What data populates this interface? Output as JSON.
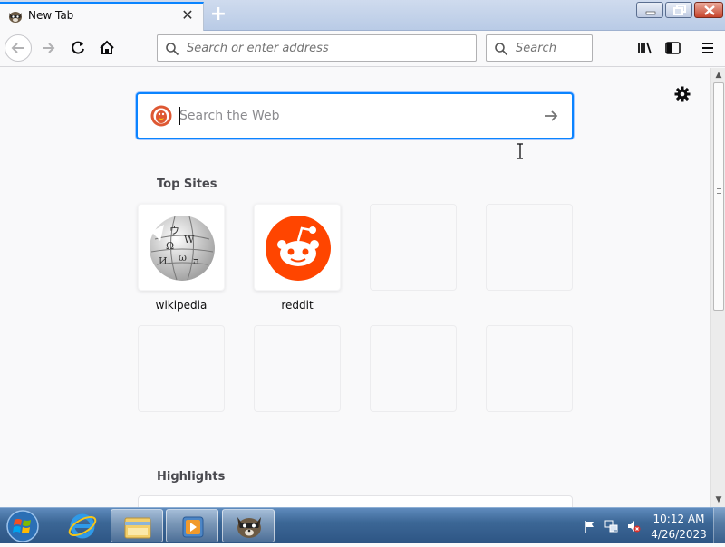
{
  "browser": {
    "tab": {
      "title": "New Tab",
      "favicon": "firefox-raccoon-icon"
    },
    "new_tab_symbol": "+",
    "nav": {
      "url_placeholder": "Search or enter address",
      "search_placeholder": "Search"
    }
  },
  "newtab": {
    "search_placeholder": "Search the Web",
    "top_sites_title": "Top Sites",
    "top_sites": [
      {
        "label": "wikipedia",
        "icon": "wikipedia-globe-icon"
      },
      {
        "label": "reddit",
        "icon": "reddit-icon"
      },
      {
        "label": "",
        "icon": ""
      },
      {
        "label": "",
        "icon": ""
      },
      {
        "label": "",
        "icon": ""
      },
      {
        "label": "",
        "icon": ""
      },
      {
        "label": "",
        "icon": ""
      },
      {
        "label": "",
        "icon": ""
      }
    ],
    "highlights_title": "Highlights"
  },
  "taskbar": {
    "pinned": [
      "internet-explorer-icon",
      "file-explorer-icon",
      "media-player-icon",
      "firefox-icon"
    ],
    "clock_time": "10:12 AM",
    "clock_date": "4/26/2023"
  },
  "colors": {
    "accent": "#0a84ff",
    "reddit": "#ff4500",
    "duckduckgo": "#de5833"
  }
}
